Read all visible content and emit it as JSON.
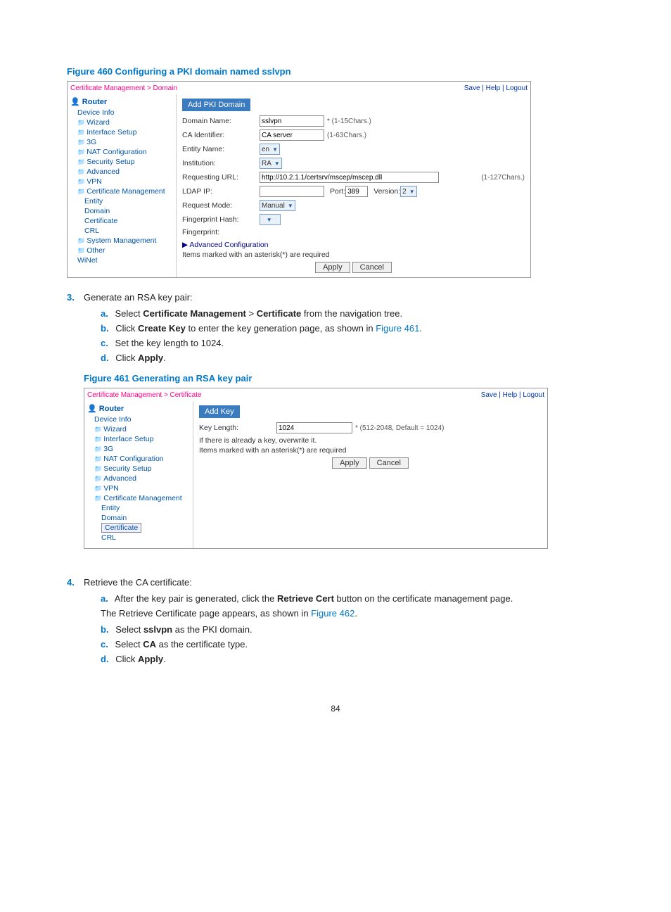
{
  "figure460": {
    "title": "Figure 460 Configuring a PKI domain named sslvpn",
    "breadcrumb": "Certificate Management > Domain",
    "toplinks": "Save | Help | Logout",
    "panelHeader": "Add PKI Domain",
    "tree": {
      "root": "Router",
      "items": [
        "Device Info",
        "Wizard",
        "Interface Setup",
        "3G",
        "NAT Configuration",
        "Security Setup",
        "Advanced",
        "VPN",
        "Certificate Management"
      ],
      "certChildren": [
        "Entity",
        "Domain",
        "Certificate",
        "CRL"
      ],
      "after": [
        "System Management",
        "Other",
        "WiNet"
      ]
    },
    "rows": {
      "domainName": {
        "label": "Domain Name:",
        "value": "sslvpn",
        "hint": "* (1-15Chars.)"
      },
      "caId": {
        "label": "CA Identifier:",
        "value": "CA server",
        "hint": "(1-63Chars.)"
      },
      "entityName": {
        "label": "Entity Name:",
        "value": "en"
      },
      "institution": {
        "label": "Institution:",
        "value": "RA"
      },
      "reqUrl": {
        "label": "Requesting URL:",
        "value": "http://10.2.1.1/certsrv/mscep/mscep.dll",
        "hint": "(1-127Chars.)"
      },
      "ldapIp": {
        "label": "LDAP IP:",
        "value": "",
        "port": {
          "label": "Port:",
          "value": "389"
        },
        "version": {
          "label": "Version:",
          "value": "2"
        }
      },
      "requestMode": {
        "label": "Request Mode:",
        "value": "Manual"
      },
      "fingerprintHash": {
        "label": "Fingerprint Hash:",
        "value": ""
      },
      "fingerprint": {
        "label": "Fingerprint:"
      }
    },
    "advanced": "Advanced Configuration",
    "note": "Items marked with an asterisk(*) are required",
    "apply": "Apply",
    "cancel": "Cancel"
  },
  "step3": {
    "num": "3.",
    "text": "Generate an RSA key pair:",
    "subs": [
      {
        "let": "a.",
        "pre": "Select ",
        "b1": "Certificate Management",
        "mid": " > ",
        "b2": "Certificate",
        "post": " from the navigation tree."
      },
      {
        "let": "b.",
        "pre": "Click ",
        "b1": "Create Key",
        "post": " to enter the key generation page, as shown in ",
        "link": "Figure 461",
        "tail": "."
      },
      {
        "let": "c.",
        "text": "Set the key length to 1024."
      },
      {
        "let": "d.",
        "pre": "Click ",
        "b1": "Apply",
        "post": "."
      }
    ]
  },
  "figure461": {
    "title": "Figure 461 Generating an RSA key pair",
    "breadcrumb": "Certificate Management > Certificate",
    "toplinks": "Save | Help | Logout",
    "panelHeader": "Add Key",
    "tree": {
      "root": "Router",
      "items": [
        "Device Info",
        "Wizard",
        "Interface Setup",
        "3G",
        "NAT Configuration",
        "Security Setup",
        "Advanced",
        "VPN",
        "Certificate Management"
      ],
      "certChildren": [
        "Entity",
        "Domain",
        "Certificate",
        "CRL"
      ]
    },
    "keyLength": {
      "label": "Key Length:",
      "value": "1024",
      "hint": "* (512-2048, Default = 1024)"
    },
    "overwrite": "If there is already a key, overwrite it.",
    "note": "Items marked with an asterisk(*) are required",
    "apply": "Apply",
    "cancel": "Cancel"
  },
  "step4": {
    "num": "4.",
    "text": "Retrieve the CA certificate:",
    "subs": [
      {
        "let": "a.",
        "pre": "After the key pair is generated, click the ",
        "b1": "Retrieve Cert",
        "post": " button on the certificate management page."
      },
      {
        "para": {
          "pre": "The Retrieve Certificate page appears, as shown in ",
          "link": "Figure 462",
          "tail": "."
        }
      },
      {
        "let": "b.",
        "pre": "Select ",
        "b1": "sslvpn",
        "post": " as the PKI domain."
      },
      {
        "let": "c.",
        "pre": "Select ",
        "b1": "CA",
        "post": " as the certificate type."
      },
      {
        "let": "d.",
        "pre": "Click ",
        "b1": "Apply",
        "post": "."
      }
    ]
  },
  "pageNum": "84"
}
